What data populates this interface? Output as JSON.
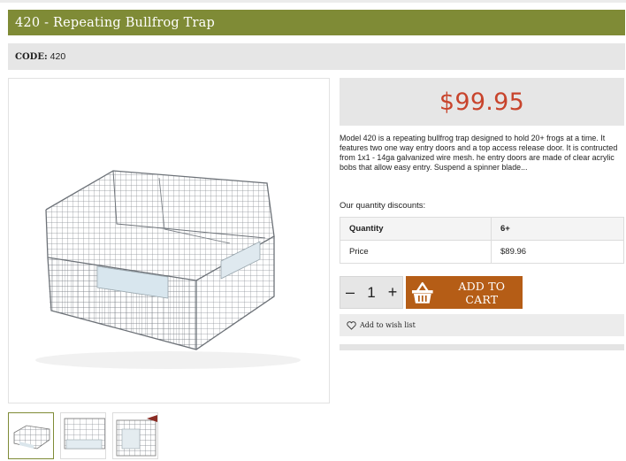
{
  "product": {
    "title": "420 - Repeating Bullfrog Trap",
    "code_label": "CODE:",
    "code_value": "420",
    "price": "$99.95",
    "description": "Model 420 is a repeating bullfrog trap designed to hold 20+ frogs at a time. It features two one way entry doors and a top access release door. It is contructed from 1x1 - 14ga galvanized wire mesh. he entry doors are made of clear acrylic bobs that allow easy entry. Suspend a spinner blade...",
    "image_icon": "wire-cage-trap-photo"
  },
  "discounts": {
    "intro": "Our quantity discounts:",
    "header": {
      "col1": "Quantity",
      "col2": "6+"
    },
    "row": {
      "col1": "Price",
      "col2": "$89.96"
    }
  },
  "cart": {
    "minus": "–",
    "quantity": "1",
    "plus": "+",
    "button_label": "ADD TO CART",
    "icon": "shopping-basket-icon"
  },
  "wishlist": {
    "label": "Add to wish list",
    "icon": "heart-icon"
  },
  "thumbnails": [
    "thumbnail-1",
    "thumbnail-2",
    "thumbnail-3"
  ],
  "colors": {
    "title_bar": "#7f8b36",
    "price": "#c8442c",
    "cart_button": "#b55d16",
    "panel_gray": "#e6e6e6"
  }
}
